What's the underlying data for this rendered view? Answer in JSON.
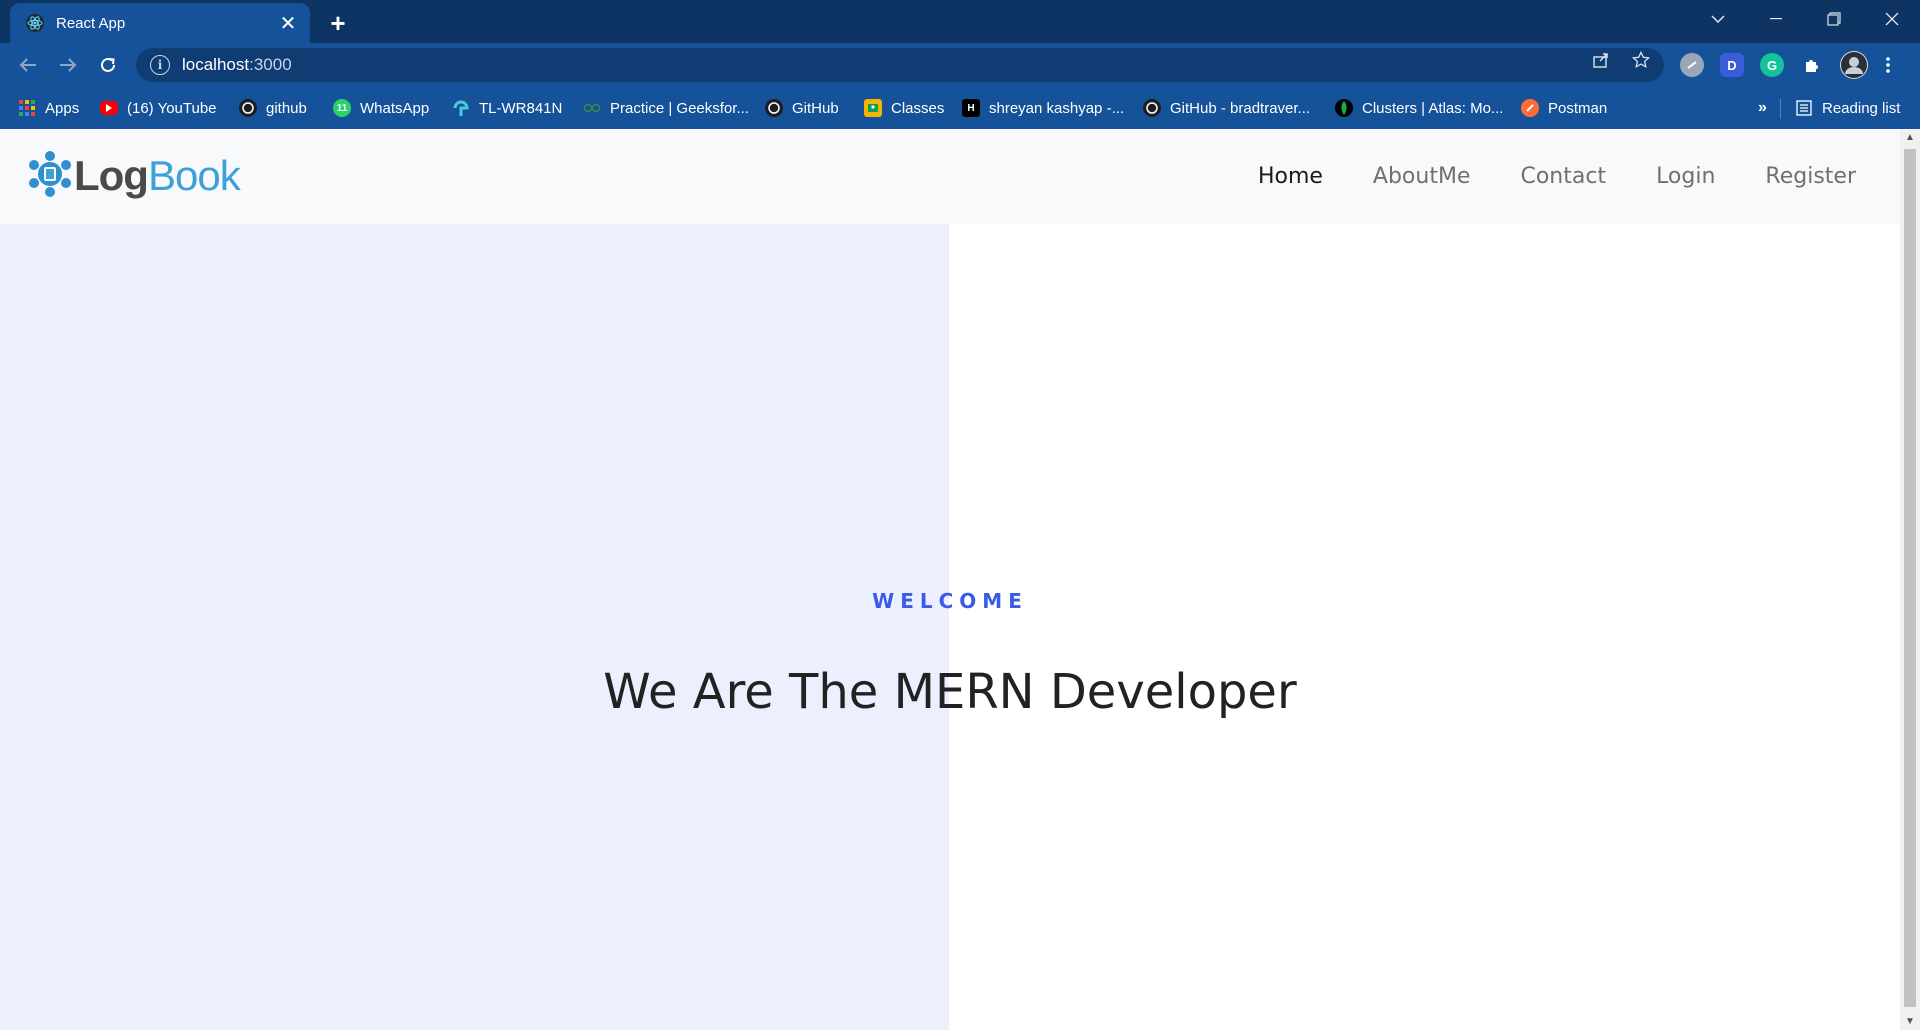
{
  "browser": {
    "tab_title": "React App",
    "tab_close": "✕",
    "new_tab": "+",
    "url_host": "localhost",
    "url_port": ":3000",
    "bookmarks": [
      {
        "label": "Apps",
        "icon": "apps-grid-icon",
        "color": "#ea4335"
      },
      {
        "label": "(16) YouTube",
        "icon": "youtube-icon",
        "color": "#ff0000"
      },
      {
        "label": "github",
        "icon": "github-icon",
        "color": "#1b1f23"
      },
      {
        "label": "WhatsApp",
        "icon": "whatsapp-icon",
        "color": "#25d366"
      },
      {
        "label": "TL-WR841N",
        "icon": "tplink-icon",
        "color": "#4acbd6"
      },
      {
        "label": "Practice | Geeksfor...",
        "icon": "geeksforgeeks-icon",
        "color": "#2f8d46"
      },
      {
        "label": "GitHub",
        "icon": "github-icon",
        "color": "#1b1f23"
      },
      {
        "label": "Classes",
        "icon": "classroom-icon",
        "color": "#f4b400"
      },
      {
        "label": "shreyan kashyap -...",
        "icon": "hashnode-icon",
        "color": "#000000"
      },
      {
        "label": "GitHub - bradtraver...",
        "icon": "github-icon",
        "color": "#1b1f23"
      },
      {
        "label": "Clusters | Atlas: Mo...",
        "icon": "mongodb-leaf-icon",
        "color": "#13aa52"
      },
      {
        "label": "Postman",
        "icon": "postman-icon",
        "color": "#ff6c37"
      }
    ],
    "overflow": "»",
    "reading_list": "Reading list",
    "extensions": [
      {
        "icon": "extension-circle-icon",
        "letter": "",
        "color": "#9aa7b8"
      },
      {
        "icon": "extension-d-icon",
        "letter": "D",
        "color": "#3b5bdb"
      },
      {
        "icon": "grammarly-icon",
        "letter": "G",
        "color": "#15c39a"
      }
    ]
  },
  "site": {
    "logo_log": "Log",
    "logo_book": "Book",
    "nav": [
      {
        "label": "Home",
        "active": true
      },
      {
        "label": "AboutMe",
        "active": false
      },
      {
        "label": "Contact",
        "active": false
      },
      {
        "label": "Login",
        "active": false
      },
      {
        "label": "Register",
        "active": false
      }
    ],
    "hero": {
      "eyebrow": "WELCOME",
      "headline": "We Are The MERN Developer"
    }
  },
  "colors": {
    "chrome_dark": "#0d3463",
    "chrome_light": "#15529a",
    "accent": "#3c5ae8",
    "hero_left_bg": "#ecf0fe"
  }
}
